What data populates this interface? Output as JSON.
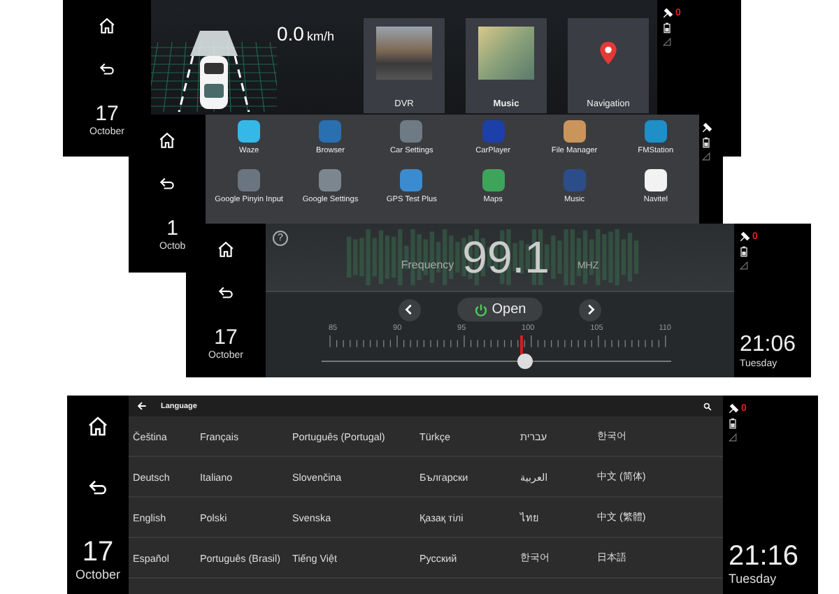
{
  "home_screen": {
    "sidebar": {
      "day": "17",
      "month": "October"
    },
    "speed": "0.0",
    "speed_unit": "km/h",
    "tiles": [
      {
        "label": "DVR",
        "kind": "photo",
        "selected": false
      },
      {
        "label": "Music",
        "kind": "photo",
        "selected": true
      },
      {
        "label": "Navigation",
        "kind": "pin",
        "selected": false
      }
    ],
    "status": {
      "count": "0"
    }
  },
  "apps_screen": {
    "sidebar": {
      "day": "1",
      "month": "Octob"
    },
    "apps": [
      "Waze",
      "Browser",
      "Car Settings",
      "CarPlayer",
      "File Manager",
      "FMStation",
      "Google Pinyin Input",
      "Google Settings",
      "GPS Test Plus",
      "Maps",
      "Music",
      "Navitel"
    ]
  },
  "radio_screen": {
    "sidebar": {
      "day": "17",
      "month": "October"
    },
    "help": "?",
    "frequency_label": "Frequency",
    "frequency": "99.1",
    "unit": "MHZ",
    "power_button": "Open",
    "scale": [
      "85",
      "90",
      "95",
      "100",
      "105",
      "110"
    ],
    "tuner": {
      "level": 0.56
    },
    "status": {
      "count": "0"
    },
    "clock": {
      "time": "21:06",
      "day": "Tuesday"
    }
  },
  "language_screen": {
    "sidebar": {
      "day": "17",
      "month": "October"
    },
    "title": "Language",
    "rows": [
      [
        "Čeština",
        "Français",
        "Português (Portugal)",
        "Türkçe",
        "עברית",
        "한국어"
      ],
      [
        "Deutsch",
        "Italiano",
        "Slovenčina",
        "Български",
        "العربية",
        "中文 (简体)"
      ],
      [
        "English",
        "Polski",
        "Svenska",
        "Қазақ тілі",
        "ไทย",
        "中文 (繁體)"
      ],
      [
        "Español",
        "Português (Brasil)",
        "Tiếng Việt",
        "Русский",
        "한국어",
        "日本語"
      ]
    ],
    "status": {
      "count": "0"
    },
    "clock": {
      "time": "21:16",
      "day": "Tuesday"
    }
  }
}
